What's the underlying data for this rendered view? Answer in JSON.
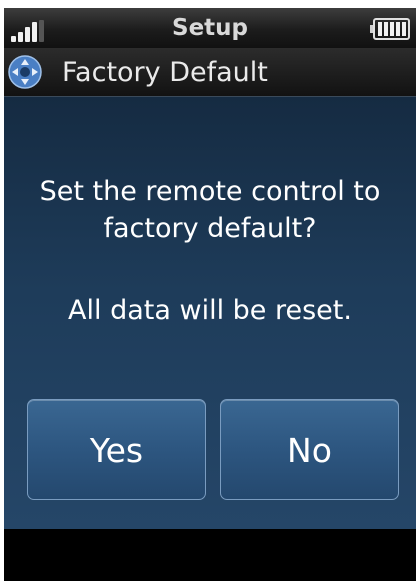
{
  "status_bar": {
    "title": "Setup",
    "signal_icon": "signal-strength-icon",
    "battery_icon": "battery-icon"
  },
  "header": {
    "title": "Factory Default",
    "icon": "dpad-icon"
  },
  "dialog": {
    "question_line1": "Set the remote control to",
    "question_line2": "factory default?",
    "warning": "All data will be reset.",
    "yes_label": "Yes",
    "no_label": "No"
  },
  "colors": {
    "dialog_top": "#152b42",
    "dialog_bottom": "#254668",
    "button": "#2d5680",
    "button_border": "#7a9cc0",
    "header_icon": "#4a7fc4"
  }
}
